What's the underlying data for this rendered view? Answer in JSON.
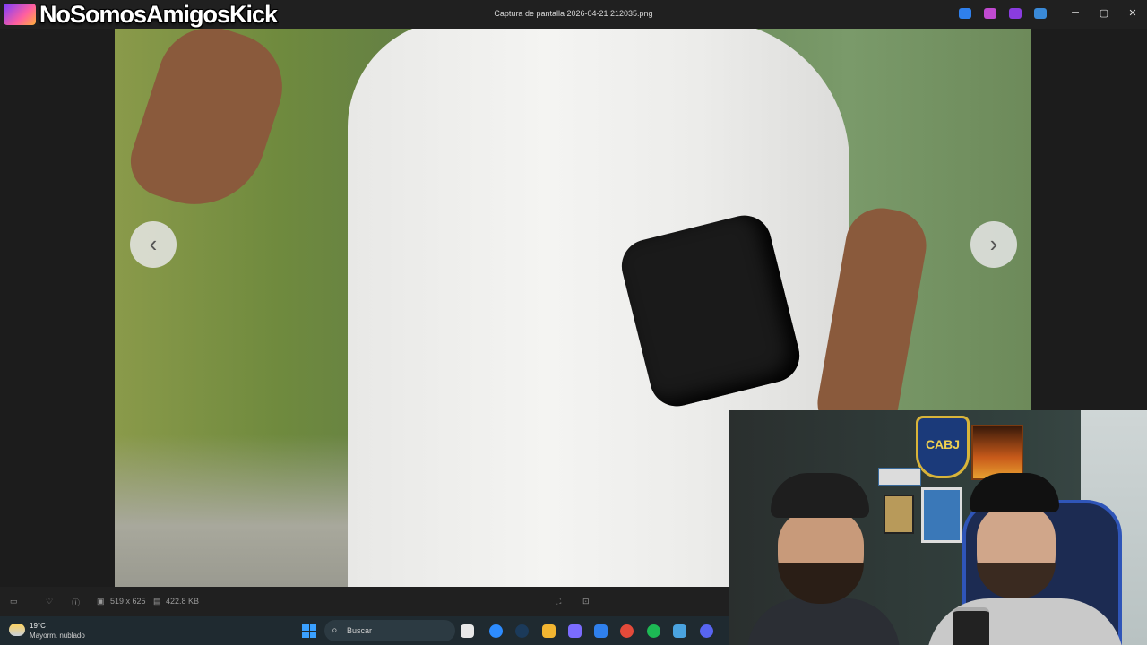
{
  "window": {
    "title": "Captura de pantalla 2026-04-21 212035.png",
    "overlay_text": "NoSomosAmigosKick"
  },
  "title_icons": [
    "edit-icon",
    "paint-icon",
    "clipchamp-icon",
    "cloud-icon"
  ],
  "window_controls": {
    "minimize": "─",
    "maximize": "▢",
    "close": "✕"
  },
  "viewer": {
    "prev_arrow": "‹",
    "next_arrow": "›"
  },
  "statusbar": {
    "dimensions": "519 x 625",
    "file_size": "422.8 KB"
  },
  "taskbar": {
    "temperature": "19°C",
    "condition": "Mayorm. nublado",
    "search_placeholder": "Buscar",
    "apps": [
      {
        "name": "file-explorer-icon",
        "color": "#f2c22e"
      },
      {
        "name": "zoom-icon",
        "color": "#2d8cff"
      },
      {
        "name": "steam-icon",
        "color": "#1b2838"
      },
      {
        "name": "folder-icon",
        "color": "#f2b531"
      },
      {
        "name": "copilot-icon",
        "color": "#7b6cff"
      },
      {
        "name": "store-icon",
        "color": "#2f80ed"
      },
      {
        "name": "chrome-icon",
        "color": "#e34a3a"
      },
      {
        "name": "spotify-icon",
        "color": "#1db954"
      },
      {
        "name": "photos-icon",
        "color": "#4aa3df"
      },
      {
        "name": "discord-icon",
        "color": "#5865f2"
      }
    ]
  },
  "webcam": {
    "shield_text": "CABJ"
  },
  "colors": {
    "titlebar": "#202020",
    "taskbar": "#1f2a30",
    "accent": "#3aa0ff"
  }
}
